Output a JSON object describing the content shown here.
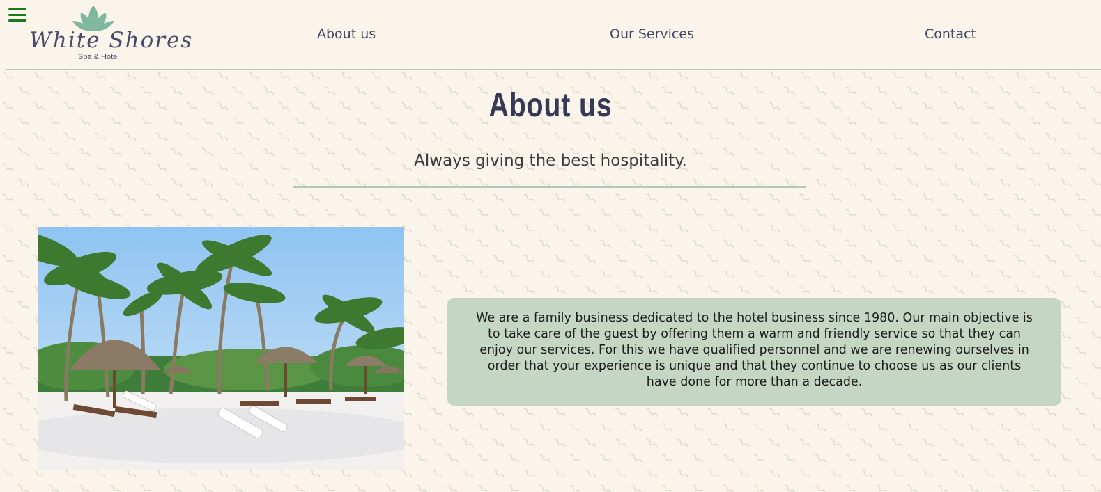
{
  "header": {
    "logo_text": "White Shores",
    "logo_subtitle": "Spa & Hotel",
    "nav": [
      {
        "label": "About us"
      },
      {
        "label": "Our Services"
      },
      {
        "label": "Contact"
      }
    ]
  },
  "main": {
    "title": "About us",
    "subtitle": "Always giving the best hospitality.",
    "description": "We are a family business dedicated to the hotel business since 1980. Our main objective is to take care of the guest by offering them a warm and friendly service so that they can enjoy our services. For this we have qualified personnel and we are renewing ourselves in order that your experience is unique and that they continue to choose us as our clients have done for more than a decade."
  },
  "colors": {
    "background": "#fbf4ea",
    "accent_green": "#157a1b",
    "info_box": "#c6d6c4",
    "heading": "#363858"
  },
  "icons": {
    "menu": "hamburger-menu-icon",
    "logo": "lotus-flower-icon"
  }
}
